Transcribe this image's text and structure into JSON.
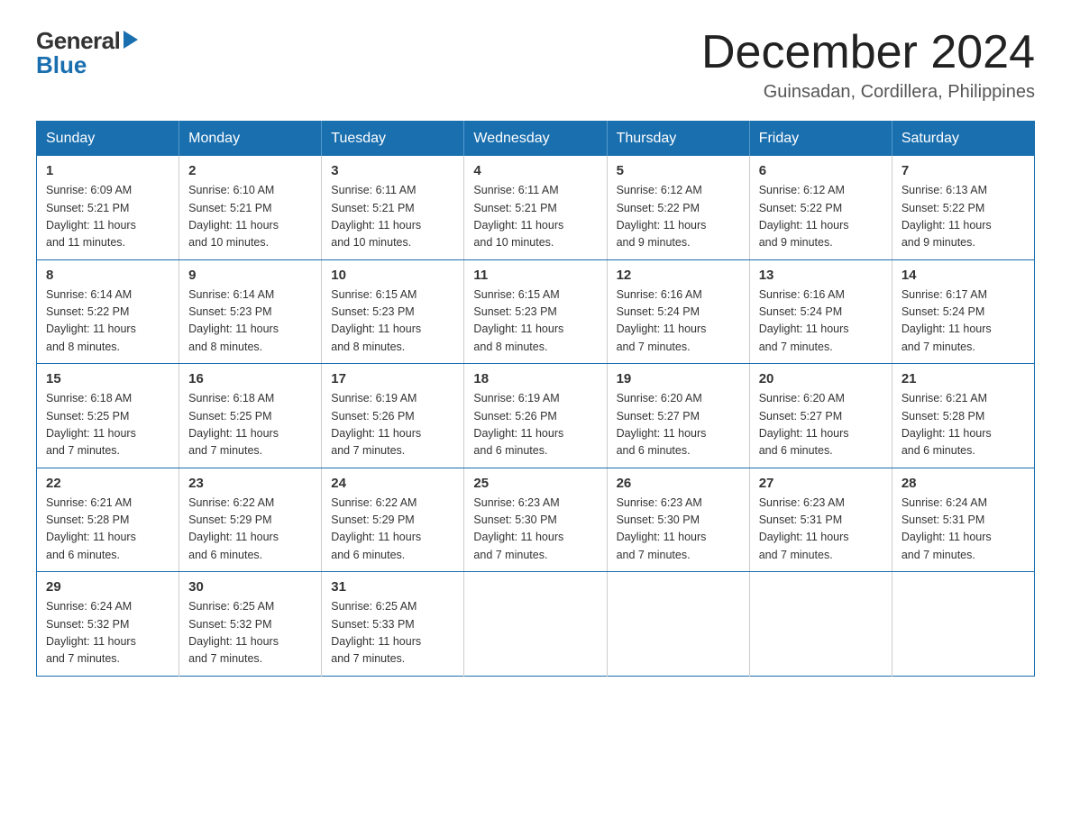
{
  "logo": {
    "general": "General",
    "blue": "Blue"
  },
  "title": "December 2024",
  "location": "Guinsadan, Cordillera, Philippines",
  "days_of_week": [
    "Sunday",
    "Monday",
    "Tuesday",
    "Wednesday",
    "Thursday",
    "Friday",
    "Saturday"
  ],
  "weeks": [
    [
      {
        "day": "1",
        "sunrise": "6:09 AM",
        "sunset": "5:21 PM",
        "daylight": "11 hours and 11 minutes."
      },
      {
        "day": "2",
        "sunrise": "6:10 AM",
        "sunset": "5:21 PM",
        "daylight": "11 hours and 10 minutes."
      },
      {
        "day": "3",
        "sunrise": "6:11 AM",
        "sunset": "5:21 PM",
        "daylight": "11 hours and 10 minutes."
      },
      {
        "day": "4",
        "sunrise": "6:11 AM",
        "sunset": "5:21 PM",
        "daylight": "11 hours and 10 minutes."
      },
      {
        "day": "5",
        "sunrise": "6:12 AM",
        "sunset": "5:22 PM",
        "daylight": "11 hours and 9 minutes."
      },
      {
        "day": "6",
        "sunrise": "6:12 AM",
        "sunset": "5:22 PM",
        "daylight": "11 hours and 9 minutes."
      },
      {
        "day": "7",
        "sunrise": "6:13 AM",
        "sunset": "5:22 PM",
        "daylight": "11 hours and 9 minutes."
      }
    ],
    [
      {
        "day": "8",
        "sunrise": "6:14 AM",
        "sunset": "5:22 PM",
        "daylight": "11 hours and 8 minutes."
      },
      {
        "day": "9",
        "sunrise": "6:14 AM",
        "sunset": "5:23 PM",
        "daylight": "11 hours and 8 minutes."
      },
      {
        "day": "10",
        "sunrise": "6:15 AM",
        "sunset": "5:23 PM",
        "daylight": "11 hours and 8 minutes."
      },
      {
        "day": "11",
        "sunrise": "6:15 AM",
        "sunset": "5:23 PM",
        "daylight": "11 hours and 8 minutes."
      },
      {
        "day": "12",
        "sunrise": "6:16 AM",
        "sunset": "5:24 PM",
        "daylight": "11 hours and 7 minutes."
      },
      {
        "day": "13",
        "sunrise": "6:16 AM",
        "sunset": "5:24 PM",
        "daylight": "11 hours and 7 minutes."
      },
      {
        "day": "14",
        "sunrise": "6:17 AM",
        "sunset": "5:24 PM",
        "daylight": "11 hours and 7 minutes."
      }
    ],
    [
      {
        "day": "15",
        "sunrise": "6:18 AM",
        "sunset": "5:25 PM",
        "daylight": "11 hours and 7 minutes."
      },
      {
        "day": "16",
        "sunrise": "6:18 AM",
        "sunset": "5:25 PM",
        "daylight": "11 hours and 7 minutes."
      },
      {
        "day": "17",
        "sunrise": "6:19 AM",
        "sunset": "5:26 PM",
        "daylight": "11 hours and 7 minutes."
      },
      {
        "day": "18",
        "sunrise": "6:19 AM",
        "sunset": "5:26 PM",
        "daylight": "11 hours and 6 minutes."
      },
      {
        "day": "19",
        "sunrise": "6:20 AM",
        "sunset": "5:27 PM",
        "daylight": "11 hours and 6 minutes."
      },
      {
        "day": "20",
        "sunrise": "6:20 AM",
        "sunset": "5:27 PM",
        "daylight": "11 hours and 6 minutes."
      },
      {
        "day": "21",
        "sunrise": "6:21 AM",
        "sunset": "5:28 PM",
        "daylight": "11 hours and 6 minutes."
      }
    ],
    [
      {
        "day": "22",
        "sunrise": "6:21 AM",
        "sunset": "5:28 PM",
        "daylight": "11 hours and 6 minutes."
      },
      {
        "day": "23",
        "sunrise": "6:22 AM",
        "sunset": "5:29 PM",
        "daylight": "11 hours and 6 minutes."
      },
      {
        "day": "24",
        "sunrise": "6:22 AM",
        "sunset": "5:29 PM",
        "daylight": "11 hours and 6 minutes."
      },
      {
        "day": "25",
        "sunrise": "6:23 AM",
        "sunset": "5:30 PM",
        "daylight": "11 hours and 7 minutes."
      },
      {
        "day": "26",
        "sunrise": "6:23 AM",
        "sunset": "5:30 PM",
        "daylight": "11 hours and 7 minutes."
      },
      {
        "day": "27",
        "sunrise": "6:23 AM",
        "sunset": "5:31 PM",
        "daylight": "11 hours and 7 minutes."
      },
      {
        "day": "28",
        "sunrise": "6:24 AM",
        "sunset": "5:31 PM",
        "daylight": "11 hours and 7 minutes."
      }
    ],
    [
      {
        "day": "29",
        "sunrise": "6:24 AM",
        "sunset": "5:32 PM",
        "daylight": "11 hours and 7 minutes."
      },
      {
        "day": "30",
        "sunrise": "6:25 AM",
        "sunset": "5:32 PM",
        "daylight": "11 hours and 7 minutes."
      },
      {
        "day": "31",
        "sunrise": "6:25 AM",
        "sunset": "5:33 PM",
        "daylight": "11 hours and 7 minutes."
      },
      null,
      null,
      null,
      null
    ]
  ],
  "labels": {
    "sunrise": "Sunrise:",
    "sunset": "Sunset:",
    "daylight": "Daylight:"
  }
}
